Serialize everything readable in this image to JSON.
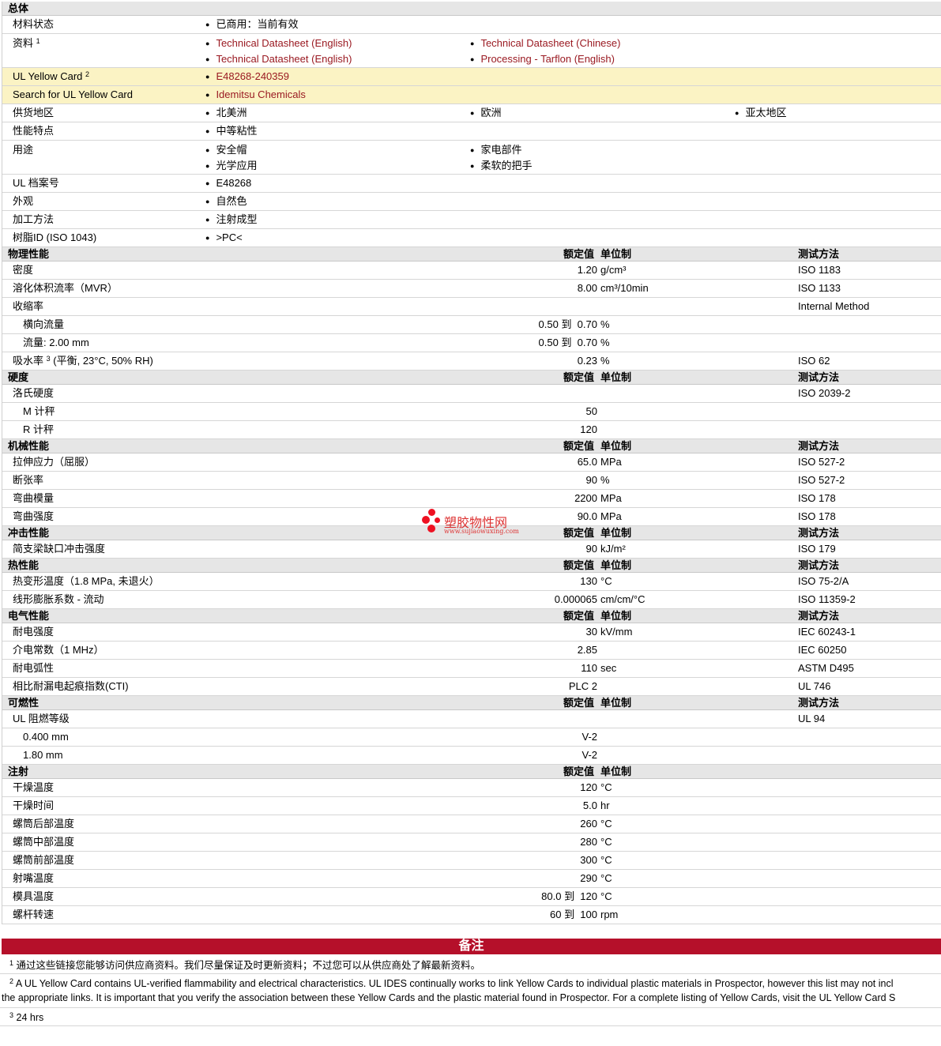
{
  "general": {
    "title": "总体",
    "material_status": {
      "label": "材料状态",
      "value": "已商用：当前有效"
    },
    "literature": {
      "label": "资料",
      "sup": "1",
      "links": [
        "Technical Datasheet (English)",
        "Technical Datasheet (Chinese)",
        "Technical Datasheet (English)",
        "Processing - Tarflon (English)"
      ]
    },
    "ul_yellow_card": {
      "label": "UL Yellow Card",
      "sup": "2",
      "value": "E48268-240359"
    },
    "search_ul": {
      "label": "Search for UL Yellow Card",
      "value": "Idemitsu Chemicals"
    },
    "availability": {
      "label": "供货地区",
      "values": [
        "北美洲",
        "欧洲",
        "亚太地区"
      ]
    },
    "features": {
      "label": "性能特点",
      "value": "中等粘性"
    },
    "uses": {
      "label": "用途",
      "values": [
        "安全帽",
        "家电部件",
        "光学应用",
        "柔软的把手"
      ]
    },
    "ul_file": {
      "label": "UL 档案号",
      "value": "E48268"
    },
    "appearance": {
      "label": "外观",
      "value": "自然色"
    },
    "processing": {
      "label": "加工方法",
      "value": "注射成型"
    },
    "resin_id": {
      "label": "树脂ID (ISO 1043)",
      "value": ">PC<"
    }
  },
  "headers": {
    "nominal": "额定值",
    "unit": "单位制",
    "method": "测试方法"
  },
  "physical": {
    "title": "物理性能",
    "rows": [
      {
        "label": "密度",
        "value": "1.20",
        "unit": "g/cm³",
        "method": "ISO 1183"
      },
      {
        "label": "溶化体积流率（MVR）",
        "value": "8.00",
        "unit": "cm³/10min",
        "method": "ISO 1133"
      },
      {
        "label": "收缩率",
        "value": "",
        "unit": "",
        "method": "Internal Method"
      },
      {
        "label": "横向流量",
        "value": "0.50 到  0.70",
        "unit": "%",
        "method": "",
        "sub": true
      },
      {
        "label": "流量: 2.00 mm",
        "value": "0.50 到  0.70",
        "unit": "%",
        "method": "",
        "sub": true
      },
      {
        "label": "吸水率",
        "sup": "3",
        "label2": " (平衡, 23°C, 50% RH)",
        "value": "0.23",
        "unit": "%",
        "method": "ISO 62"
      }
    ]
  },
  "hardness": {
    "title": "硬度",
    "rows": [
      {
        "label": "洛氏硬度",
        "value": "",
        "unit": "",
        "method": "ISO 2039-2"
      },
      {
        "label": "M 计秤",
        "value": "50",
        "unit": "",
        "method": "",
        "sub": true
      },
      {
        "label": "R 计秤",
        "value": "120",
        "unit": "",
        "method": "",
        "sub": true
      }
    ]
  },
  "mechanical": {
    "title": "机械性能",
    "rows": [
      {
        "label": "拉伸应力（屈服）",
        "value": "65.0",
        "unit": "MPa",
        "method": "ISO 527-2"
      },
      {
        "label": "断张率",
        "value": "90",
        "unit": "%",
        "method": "ISO 527-2"
      },
      {
        "label": "弯曲模量",
        "value": "2200",
        "unit": "MPa",
        "method": "ISO 178"
      },
      {
        "label": "弯曲强度",
        "value": "90.0",
        "unit": "MPa",
        "method": "ISO 178"
      }
    ]
  },
  "impact": {
    "title": "冲击性能",
    "rows": [
      {
        "label": "简支梁缺口冲击强度",
        "value": "90",
        "unit": "kJ/m²",
        "method": "ISO 179"
      }
    ]
  },
  "thermal": {
    "title": "热性能",
    "rows": [
      {
        "label": "热变形温度（1.8 MPa, 未退火）",
        "value": "130",
        "unit": "°C",
        "method": "ISO 75-2/A"
      },
      {
        "label": "线形膨胀系数 - 流动",
        "value": "0.000065",
        "unit": "cm/cm/°C",
        "method": "ISO 11359-2"
      }
    ]
  },
  "electrical": {
    "title": "电气性能",
    "rows": [
      {
        "label": "耐电强度",
        "value": "30",
        "unit": "kV/mm",
        "method": "IEC 60243-1"
      },
      {
        "label": "介电常数（1 MHz）",
        "value": "2.85",
        "unit": "",
        "method": "IEC 60250"
      },
      {
        "label": "耐电弧性",
        "value": "110",
        "unit": "sec",
        "method": "ASTM D495"
      },
      {
        "label": "相比耐漏电起痕指数(CTI)",
        "value": "PLC 2",
        "unit": "",
        "method": "UL 746"
      }
    ]
  },
  "flammability": {
    "title": "可燃性",
    "rows": [
      {
        "label": "UL 阻燃等级",
        "value": "",
        "unit": "",
        "method": "UL 94"
      },
      {
        "label": "0.400 mm",
        "value": "V-2",
        "unit": "",
        "method": "",
        "sub": true
      },
      {
        "label": "1.80 mm",
        "value": "V-2",
        "unit": "",
        "method": "",
        "sub": true
      }
    ]
  },
  "injection": {
    "title": "注射",
    "rows": [
      {
        "label": "干燥温度",
        "value": "120",
        "unit": "°C",
        "method": ""
      },
      {
        "label": "干燥时间",
        "value": "5.0",
        "unit": "hr",
        "method": ""
      },
      {
        "label": "螺筒后部温度",
        "value": "260",
        "unit": "°C",
        "method": ""
      },
      {
        "label": "螺筒中部温度",
        "value": "280",
        "unit": "°C",
        "method": ""
      },
      {
        "label": "螺筒前部温度",
        "value": "300",
        "unit": "°C",
        "method": ""
      },
      {
        "label": "射嘴温度",
        "value": "290",
        "unit": "°C",
        "method": ""
      },
      {
        "label": "模具温度",
        "value": "80.0 到  120",
        "unit": "°C",
        "method": ""
      },
      {
        "label": "螺杆转速",
        "value": "60 到  100",
        "unit": "rpm",
        "method": ""
      }
    ]
  },
  "notes": {
    "title": "备注",
    "n1": {
      "sup": "1",
      "text": "通过这些链接您能够访问供应商资料。我们尽量保证及时更新资料；不过您可以从供应商处了解最新资料。"
    },
    "n2": {
      "sup": "2",
      "line1": "A UL Yellow Card contains UL-verified flammability and electrical characteristics. UL IDES continually works to link Yellow Cards to individual plastic materials in Prospector, however this list may not incl",
      "line2": "the appropriate links. It is important that you verify the association between these Yellow Cards and the plastic material found in Prospector. For a complete listing of Yellow Cards, visit the UL Yellow Card S"
    },
    "n3": {
      "sup": "3",
      "text": "24 hrs"
    }
  },
  "watermark": {
    "text": "塑胶物性网",
    "url": "www.sujiaowuxing.com"
  }
}
